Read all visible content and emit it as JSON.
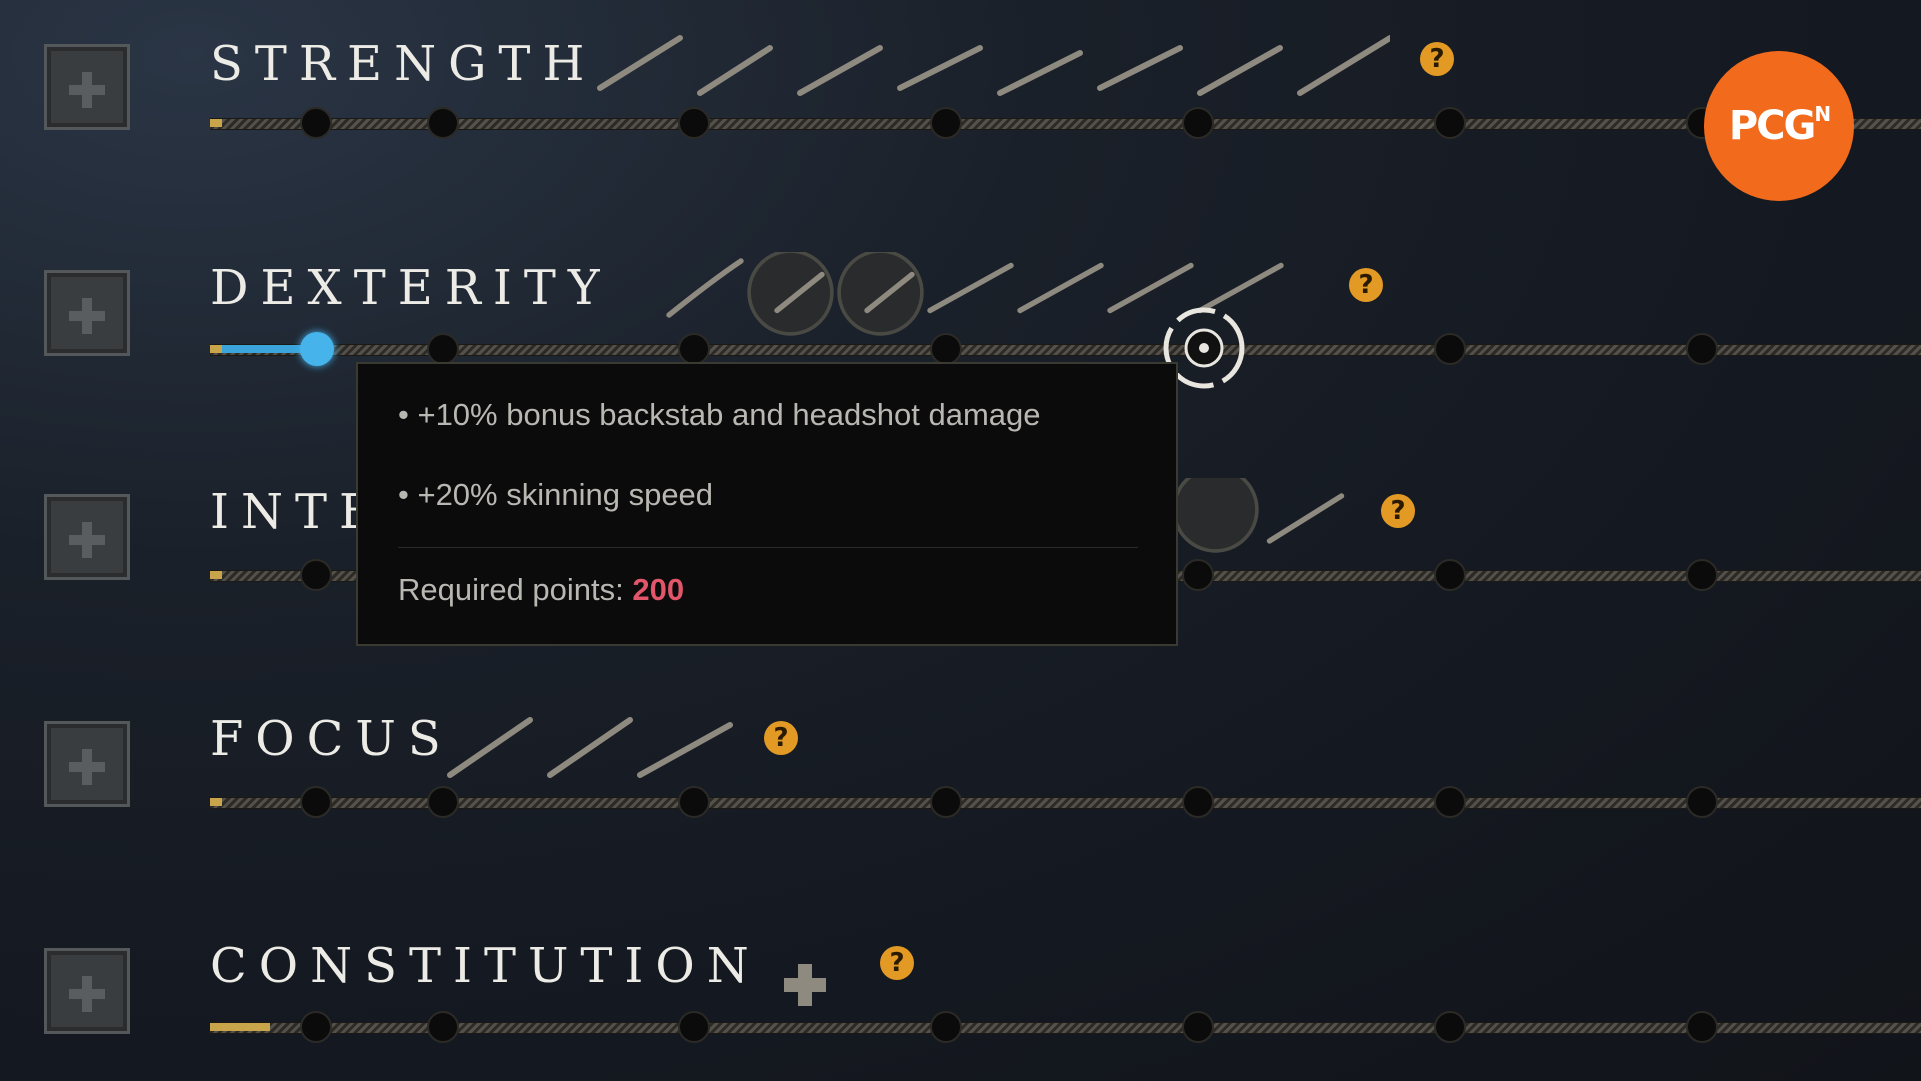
{
  "attributes": [
    {
      "name": "STRENGTH",
      "help": "?"
    },
    {
      "name": "DEXTERITY",
      "help": "?"
    },
    {
      "name": "INTE",
      "help": "?"
    },
    {
      "name": "FOCUS",
      "help": "?"
    },
    {
      "name": "CONSTITUTION",
      "help": "?"
    }
  ],
  "dexterity_progress": 0.05,
  "tooltip": {
    "bullet1": "• +10% bonus backstab and headshot damage",
    "bullet2": "• +20% skinning speed",
    "required_label": "Required points:",
    "required_value": "200"
  },
  "logo": {
    "text": "PCG",
    "sup": "N"
  },
  "colors": {
    "accent": "#e39a25",
    "slider": "#3aa4db",
    "required": "#e2566a",
    "logo": "#f26a1b"
  }
}
